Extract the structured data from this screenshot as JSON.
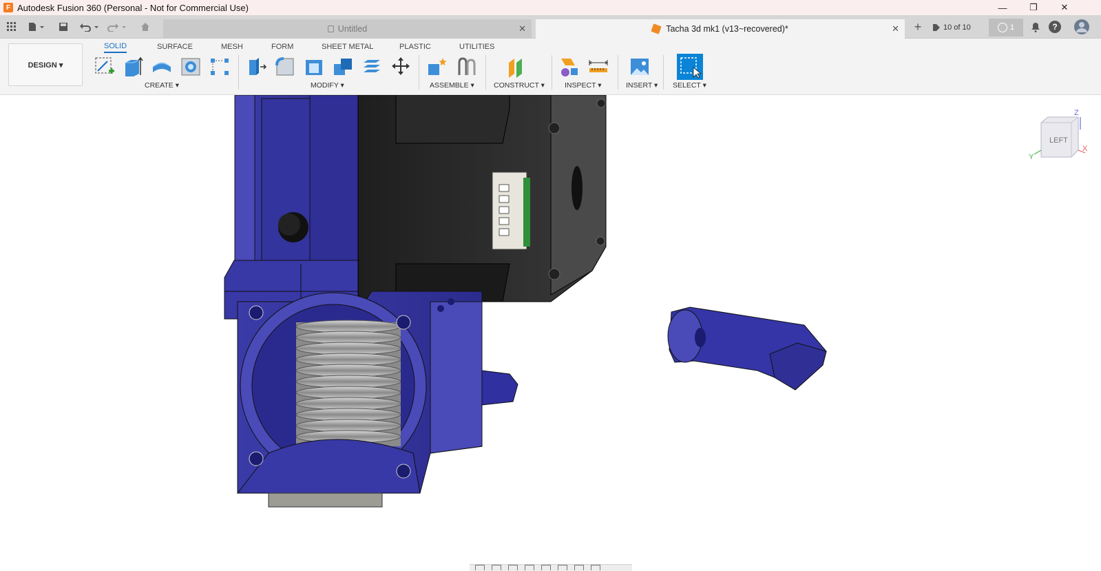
{
  "window": {
    "title": "Autodesk Fusion 360 (Personal - Not for Commercial Use)",
    "app_icon": "F",
    "minimize_label": "—",
    "restore_label": "❐",
    "close_label": "✕"
  },
  "tabs": [
    {
      "label": "Untitled",
      "active": false,
      "locked": true
    },
    {
      "label": "Tacha 3d mk1 (v13~recovered)*",
      "active": true,
      "locked": false
    }
  ],
  "tab_close_label": "✕",
  "tabbar": {
    "version_label": "10 of 10",
    "jobs_count": "1",
    "help_label": "?",
    "new_tab_label": "+"
  },
  "toolbar": {
    "workspace_label": "DESIGN ▾",
    "workspace_tabs": [
      "SOLID",
      "SURFACE",
      "MESH",
      "FORM",
      "SHEET METAL",
      "PLASTIC",
      "UTILITIES"
    ],
    "active_workspace_tab": "SOLID",
    "groups": [
      "CREATE ▾",
      "MODIFY ▾",
      "ASSEMBLE ▾",
      "CONSTRUCT ▾",
      "INSPECT ▾",
      "INSERT ▾",
      "SELECT ▾"
    ]
  },
  "viewcube": {
    "face_label": "LEFT",
    "axis_z": "Z",
    "axis_x": "X",
    "axis_y": "Y"
  },
  "colors": {
    "part_blue": "#3a3aa8",
    "motor_black": "#2b2b2b",
    "accent": "#1a6fc0",
    "select_blue": "#0a84d6"
  }
}
